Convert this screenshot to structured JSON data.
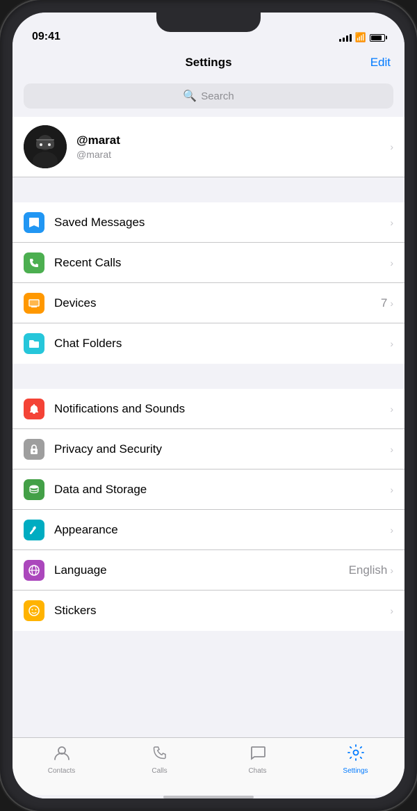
{
  "statusBar": {
    "time": "09:41"
  },
  "header": {
    "title": "Settings",
    "editLabel": "Edit"
  },
  "search": {
    "placeholder": "Search"
  },
  "profile": {
    "name": "@marat",
    "handle": "@marat"
  },
  "groups": [
    {
      "id": "shortcuts",
      "items": [
        {
          "label": "Saved Messages",
          "icon": "bookmark",
          "iconColor": "icon-blue",
          "value": "",
          "unicode": "🔖"
        },
        {
          "label": "Recent Calls",
          "icon": "phone",
          "iconColor": "icon-green",
          "value": "",
          "unicode": "📞"
        },
        {
          "label": "Devices",
          "icon": "monitor",
          "iconColor": "icon-orange",
          "value": "7",
          "unicode": "🖥"
        },
        {
          "label": "Chat Folders",
          "icon": "folder",
          "iconColor": "icon-teal",
          "value": "",
          "unicode": "📁"
        }
      ]
    },
    {
      "id": "settings",
      "items": [
        {
          "label": "Notifications and Sounds",
          "icon": "bell",
          "iconColor": "icon-red",
          "value": "",
          "unicode": "🔔"
        },
        {
          "label": "Privacy and Security",
          "icon": "lock",
          "iconColor": "icon-gray",
          "value": "",
          "unicode": "🔒"
        },
        {
          "label": "Data and Storage",
          "icon": "database",
          "iconColor": "icon-green2",
          "value": "",
          "unicode": "💾"
        },
        {
          "label": "Appearance",
          "icon": "brush",
          "iconColor": "icon-cyan",
          "value": "",
          "unicode": "🖌"
        },
        {
          "label": "Language",
          "icon": "globe",
          "iconColor": "icon-purple",
          "value": "English",
          "unicode": "🌐"
        },
        {
          "label": "Stickers",
          "icon": "sticker",
          "iconColor": "icon-amber",
          "value": "",
          "unicode": "😊"
        }
      ]
    }
  ],
  "tabBar": {
    "tabs": [
      {
        "label": "Contacts",
        "icon": "👤",
        "active": false
      },
      {
        "label": "Calls",
        "icon": "📞",
        "active": false
      },
      {
        "label": "Chats",
        "icon": "💬",
        "active": false
      },
      {
        "label": "Settings",
        "icon": "⚙️",
        "active": true
      }
    ]
  }
}
